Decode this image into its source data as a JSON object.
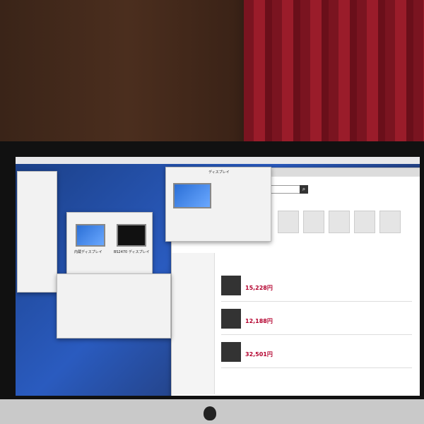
{
  "scene": {
    "description_tags": [
      "photo-of-imac-screen"
    ]
  },
  "browser": {
    "search_button_icon": "search-icon",
    "price_1": "15,228円",
    "price_2": "12,188円",
    "price_3": "32,501円"
  },
  "dialog": {
    "left_label": "内蔵ディスプレイ",
    "right_label": "BS2470 ディスプレイ"
  },
  "prefs": {
    "tab_label": "ディスプレイ"
  }
}
